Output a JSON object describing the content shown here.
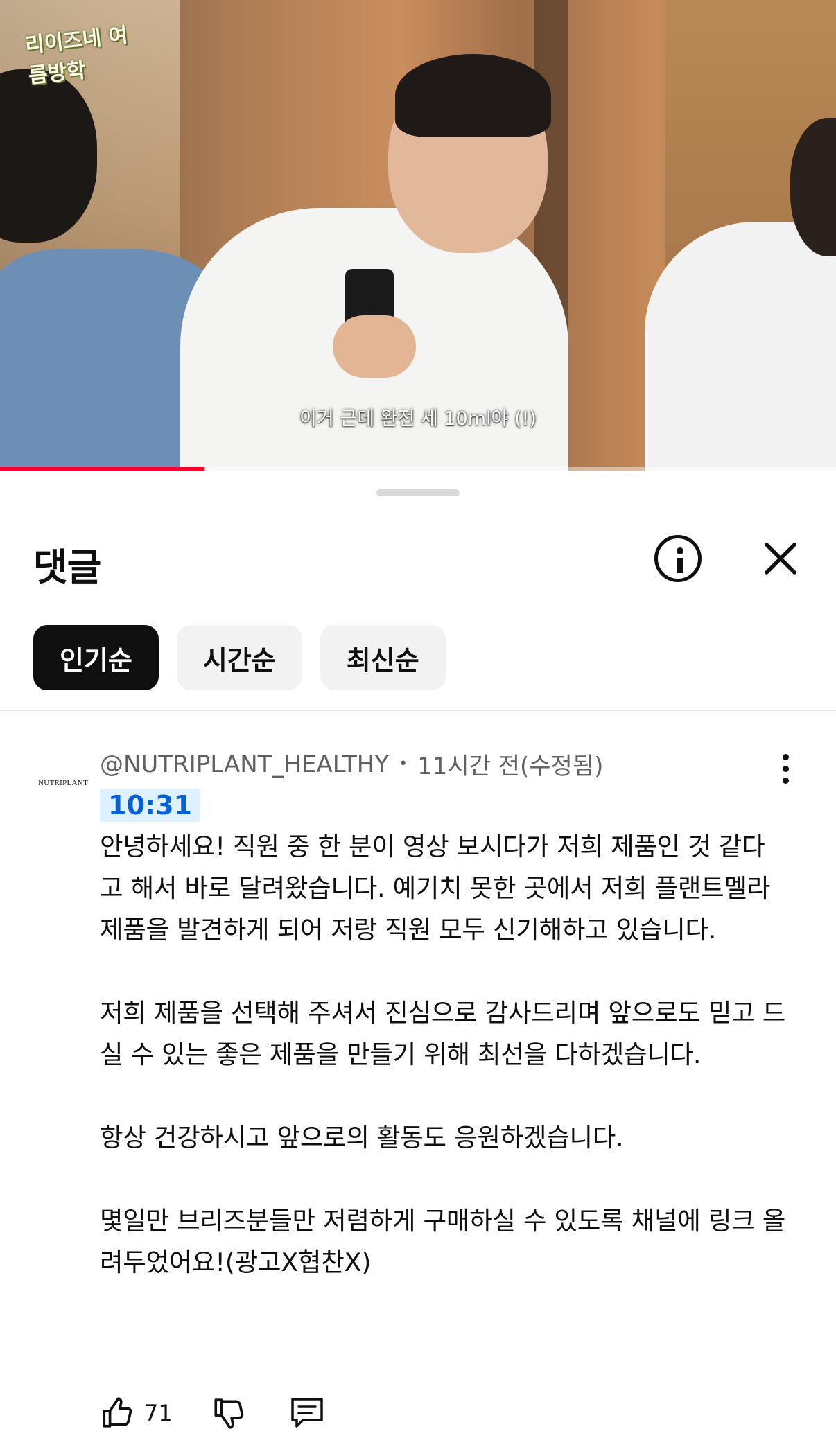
{
  "video": {
    "channel_logo": "리이즈네 여름방학",
    "subtitle": "이거 근데 완전 세 10ml야 (!)",
    "progress_fraction": 0.245,
    "progress_color": "#ff0033"
  },
  "sheet": {
    "title": "댓글",
    "info_icon": "info-icon",
    "close_icon": "close-icon",
    "sort_chips": [
      {
        "label": "인기순",
        "active": true
      },
      {
        "label": "시간순",
        "active": false
      },
      {
        "label": "최신순",
        "active": false
      }
    ]
  },
  "comment": {
    "avatar_text": "NUTRIPLANT",
    "author": "@NUTRIPLANT_HEALTHY",
    "separator": "•",
    "time": "11시간 전(수정됨)",
    "timestamp_link": "10:31",
    "paragraphs": [
      "안녕하세요! 직원 중 한 분이 영상 보시다가 저희 제품인 것 같다고 해서 바로 달려왔습니다. 예기치 못한 곳에서 저희 플랜트멜라 제품을 발견하게 되어 저랑 직원 모두 신기해하고 있습니다.",
      "저희 제품을 선택해 주셔서 진심으로 감사드리며 앞으로도 믿고 드실 수 있는 좋은 제품을 만들기 위해 최선을 다하겠습니다.",
      "항상 건강하시고 앞으로의 활동도 응원하겠습니다.",
      "몇일만 브리즈분들만 저렴하게 구매하실 수 있도록 채널에 링크 올려두었어요!(광고X협찬X)"
    ],
    "like_count": "71",
    "icons": [
      "thumbs-up-icon",
      "thumbs-down-icon",
      "reply-icon",
      "more-vert-icon"
    ]
  },
  "colors": {
    "accent_blue": "#065fd4",
    "timestamp_bg": "#def1ff",
    "chip_active_bg": "#0f0f0f",
    "chip_bg": "#f2f2f2"
  }
}
